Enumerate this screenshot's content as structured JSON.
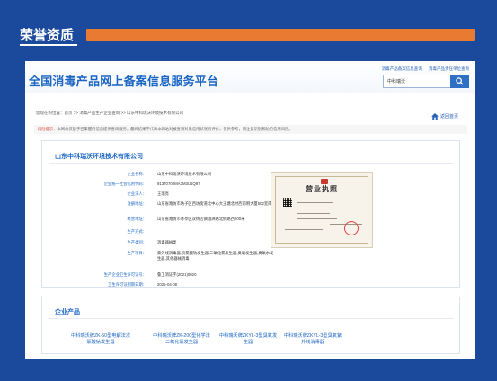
{
  "section": {
    "title": "荣誉资质"
  },
  "site": {
    "title": "全国消毒产品网上备案信息服务平台",
    "top_links": [
      "消毒产品备案信息查询",
      "消毒产品责任单位查询"
    ],
    "search_value": "中科瑞沃"
  },
  "breadcrumb": "您现在的位置：首页 >> 消毒产品生产企业查询 >> 山东中科瑞沃环境技术有限公司",
  "home_link": "返回首页",
  "notice": {
    "label": "风险提示：",
    "text": "本网站仅基于已掌握的信息提供查询服务，最终结果不代表本网站对被查询对象信用状况的评价，仅供参考，请注意识别和防范信用风险。"
  },
  "company": {
    "name": "山东中科瑞沃环境技术有限公司",
    "fields": [
      {
        "label": "企业名称：",
        "value": "山东中科瑞沃环境技术有限公司"
      },
      {
        "label": "企业统一社会信用代码：",
        "value": "91370700MA3M3U1Q97"
      },
      {
        "label": "企业法人：",
        "value": "王瑞亮"
      },
      {
        "label": "注册地址：",
        "value": "山东省潍坊市坊子区西坊街道北中心大王塘北村西南侧大厦502室南"
      },
      {
        "label": "经营地址：",
        "value": "山东省潍坊市寒亭区双杨店镇潍洲路北侧路西200米"
      },
      {
        "label": "生产方式：",
        "value": ""
      },
      {
        "label": "生产类别：",
        "value": "消毒器械类"
      },
      {
        "label": "生产项目：",
        "value": "紫外线消毒器,次氯酸钠发生器,二氧化氯发生器,臭氧发生器,臭氧水发生器,其他器械消毒"
      },
      {
        "label": "生产企业卫生许可证号：",
        "value": "鲁卫消证字(2021)0020"
      },
      {
        "label": "卫生许可证到期日期：",
        "value": "2025-04-08"
      }
    ],
    "license_title": "营业执照"
  },
  "products": {
    "title": "企业产品",
    "items": [
      "中科瑞沃牌ZK-50型电解法次氯酸钠发生器",
      "中科瑞沃牌ZK-200型化学法二氧化氯发生器",
      "中科瑞沃牌ZKYL-3型臭氧发生器",
      "中科瑞沃牌ZKYL-3型臭氧紫外线消毒器"
    ]
  },
  "colors": {
    "background": "#1b4a9c",
    "accent_bar": "#e87a32",
    "link_blue": "#1a64c4",
    "warning_red": "#d23b2b"
  }
}
